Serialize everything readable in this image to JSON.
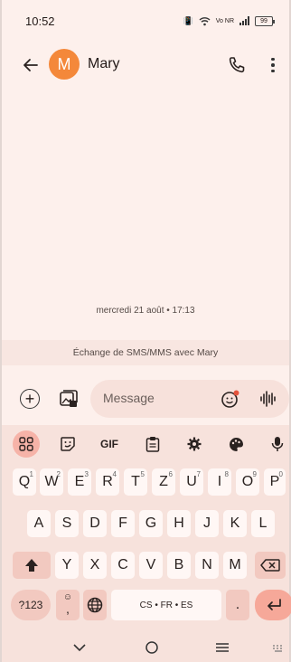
{
  "status_bar": {
    "time": "10:52",
    "battery": "99",
    "network": "Vo NR"
  },
  "header": {
    "avatar_letter": "M",
    "contact_name": "Mary"
  },
  "conversation": {
    "date_stamp": "mercredi 21 août • 17:13",
    "sms_banner": "Échange de SMS/MMS avec Mary"
  },
  "compose": {
    "placeholder": "Message"
  },
  "keyboard": {
    "toolbar": {
      "gif_label": "GIF"
    },
    "row1": [
      {
        "k": "Q",
        "n": "1"
      },
      {
        "k": "W",
        "n": "2"
      },
      {
        "k": "E",
        "n": "3"
      },
      {
        "k": "R",
        "n": "4"
      },
      {
        "k": "T",
        "n": "5"
      },
      {
        "k": "Z",
        "n": "6"
      },
      {
        "k": "U",
        "n": "7"
      },
      {
        "k": "I",
        "n": "8"
      },
      {
        "k": "O",
        "n": "9"
      },
      {
        "k": "P",
        "n": "0"
      }
    ],
    "row2": [
      "A",
      "S",
      "D",
      "F",
      "G",
      "H",
      "J",
      "K",
      "L"
    ],
    "row3": [
      "Y",
      "X",
      "C",
      "V",
      "B",
      "N",
      "M"
    ],
    "symbols_label": "?123",
    "comma_label": ",",
    "space_label": "CS • FR • ES",
    "period_label": "."
  }
}
